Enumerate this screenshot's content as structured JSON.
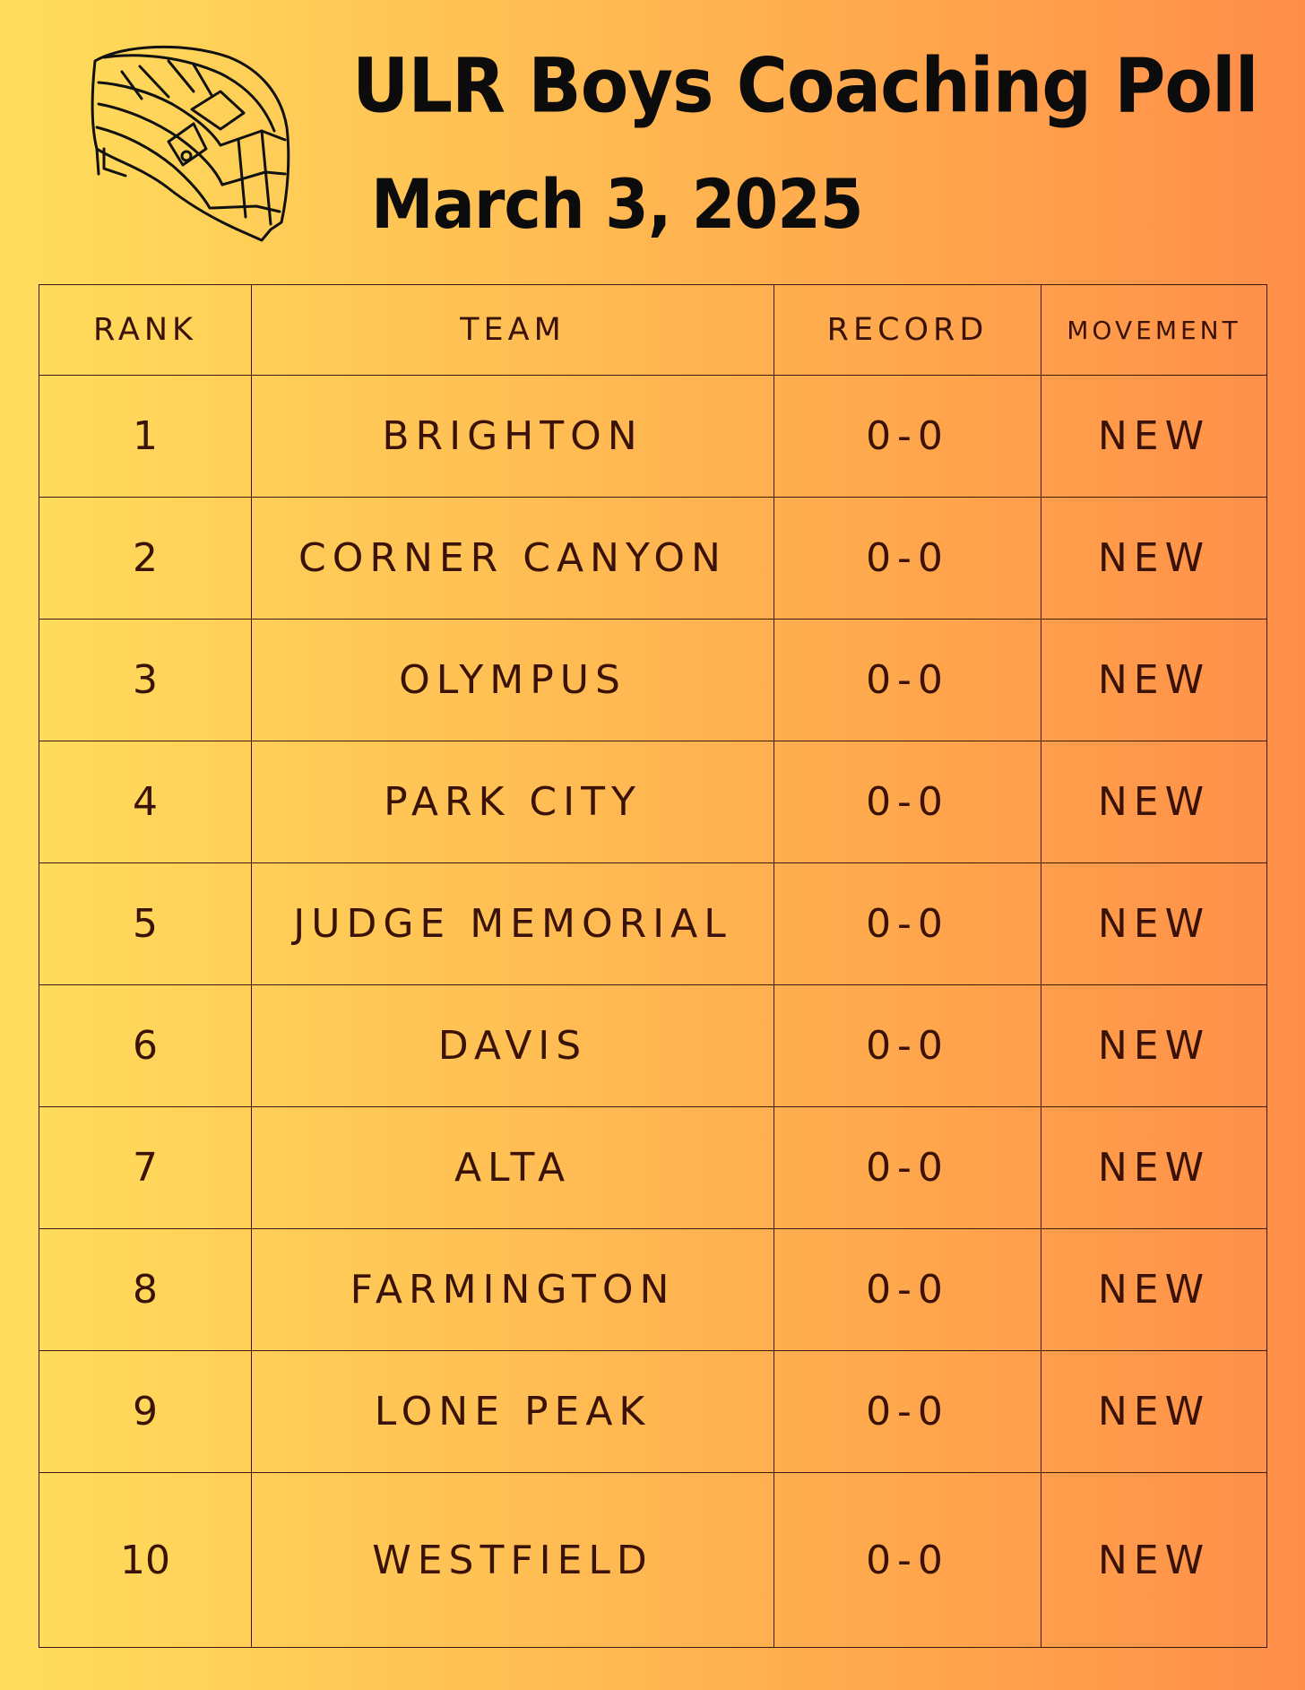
{
  "title": "ULR Boys Coaching Poll",
  "date": "March 3, 2025",
  "logo_icon": "lacrosse-helmet-icon",
  "colors": {
    "gradient_start": "#ffde5c",
    "gradient_end": "#ff8e49",
    "text": "#3a1208",
    "heading": "#0c0c0c"
  },
  "table": {
    "headers": {
      "rank": "RANK",
      "team": "TEAM",
      "record": "RECORD",
      "movement": "MOVEMENT"
    },
    "rows": [
      {
        "rank": "1",
        "team": "BRIGHTON",
        "record": "0-0",
        "movement": "NEW"
      },
      {
        "rank": "2",
        "team": "CORNER CANYON",
        "record": "0-0",
        "movement": "NEW"
      },
      {
        "rank": "3",
        "team": "OLYMPUS",
        "record": "0-0",
        "movement": "NEW"
      },
      {
        "rank": "4",
        "team": "PARK CITY",
        "record": "0-0",
        "movement": "NEW"
      },
      {
        "rank": "5",
        "team": "JUDGE MEMORIAL",
        "record": "0-0",
        "movement": "NEW"
      },
      {
        "rank": "6",
        "team": "DAVIS",
        "record": "0-0",
        "movement": "NEW"
      },
      {
        "rank": "7",
        "team": "ALTA",
        "record": "0-0",
        "movement": "NEW"
      },
      {
        "rank": "8",
        "team": "FARMINGTON",
        "record": "0-0",
        "movement": "NEW"
      },
      {
        "rank": "9",
        "team": "LONE PEAK",
        "record": "0-0",
        "movement": "NEW"
      },
      {
        "rank": "10",
        "team": "WESTFIELD",
        "record": "0-0",
        "movement": "NEW"
      }
    ]
  }
}
